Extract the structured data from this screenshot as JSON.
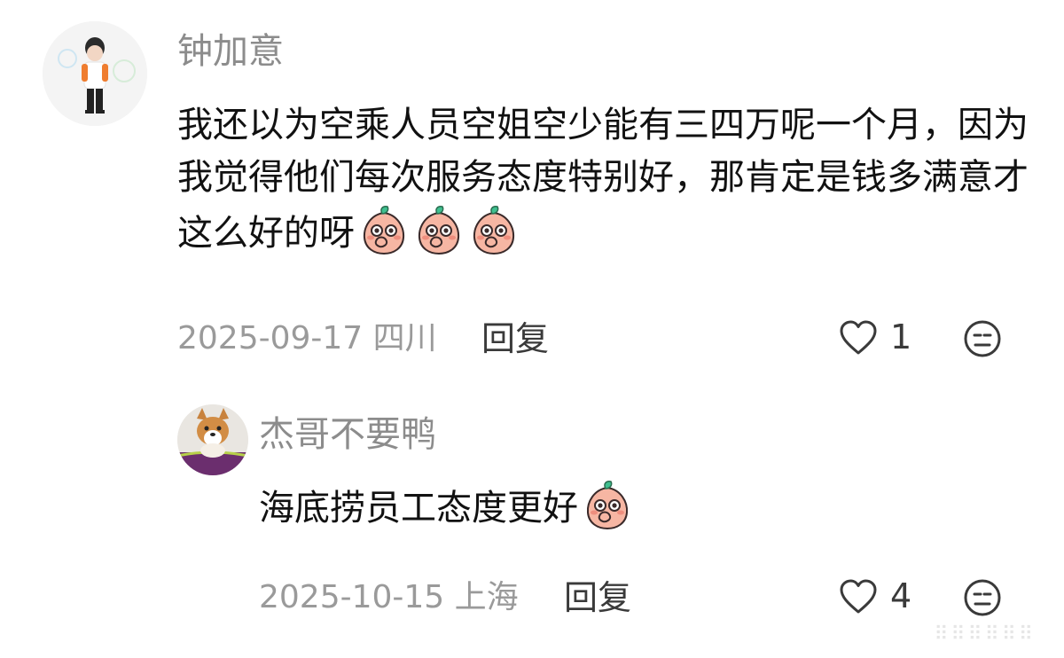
{
  "comment": {
    "username": "钟加意",
    "text": "我还以为空乘人员空姐空少能有三四万呢一个月，因为我觉得他们每次服务态度特别好，那肯定是钱多满意才这么好的呀",
    "emoji_count": 3,
    "date": "2025-09-17",
    "location": "四川",
    "reply_label": "回复",
    "likes": "1"
  },
  "reply": {
    "username": "杰哥不要鸭",
    "text": "海底捞员工态度更好",
    "emoji_count": 1,
    "date": "2025-10-15",
    "location": "上海",
    "reply_label": "回复",
    "likes": "4"
  },
  "icons": {
    "like": "heart-outline-icon",
    "dislike": "meh-face-icon",
    "emoji": "peach-cover-mouth-emoji"
  },
  "colors": {
    "username": "#8c8c8c",
    "text": "#111111",
    "meta": "#9a9a9a",
    "action": "#3a3a3a"
  }
}
